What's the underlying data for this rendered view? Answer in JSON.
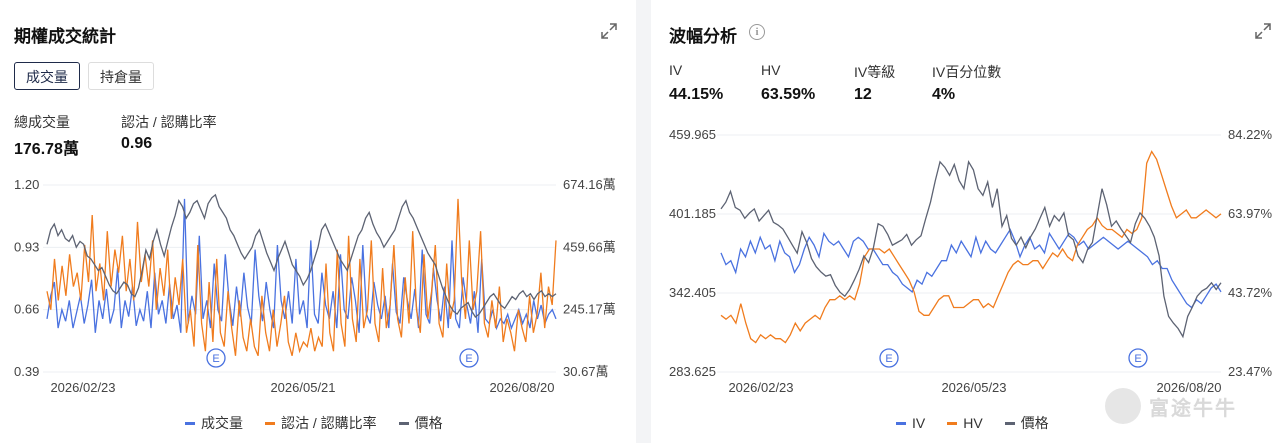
{
  "left_panel": {
    "title": "期權成交統計",
    "tabs": [
      {
        "label": "成交量"
      },
      {
        "label": "持倉量"
      }
    ],
    "stats": [
      {
        "label": "總成交量",
        "value": "176.78萬"
      },
      {
        "label": "認沽 / 認購比率",
        "value": "0.96"
      }
    ]
  },
  "right_panel": {
    "title": "波幅分析",
    "stats": [
      {
        "label": "IV",
        "value": "44.15%"
      },
      {
        "label": "HV",
        "value": "63.59%"
      },
      {
        "label": "IV等級",
        "value": "12"
      },
      {
        "label": "IV百分位數",
        "value": "4%"
      }
    ]
  },
  "icons": {
    "expand": "expand-icon",
    "info": "info-icon",
    "earnings": "earnings-marker-icon",
    "logo": "futu-logo-icon"
  },
  "colors": {
    "blue": "#4a72e0",
    "orange": "#f07c1e",
    "gray": "#5d6373"
  },
  "watermark": "富途牛牛",
  "chart_data": [
    {
      "type": "line",
      "x_ticks": [
        "2026/02/23",
        "2026/05/21",
        "2026/08/20"
      ],
      "y_left": {
        "ticks": [
          "1.20",
          "0.93",
          "0.66",
          "0.39"
        ],
        "range": [
          0.39,
          1.2
        ]
      },
      "y_right": {
        "ticks": [
          "674.16萬",
          "459.66萬",
          "245.17萬",
          "30.67萬"
        ],
        "range": [
          30.67,
          674.16
        ],
        "unit": "萬"
      },
      "markers": [
        "E",
        "E"
      ],
      "series": [
        {
          "name": "成交量",
          "axis": "left",
          "color": "#4a72e0",
          "values": [
            0.62,
            0.72,
            0.78,
            0.58,
            0.66,
            0.61,
            0.7,
            0.58,
            0.65,
            0.72,
            0.6,
            0.68,
            0.79,
            0.56,
            0.7,
            0.62,
            0.75,
            0.6,
            0.66,
            0.84,
            0.58,
            0.7,
            0.63,
            0.76,
            0.59,
            0.66,
            0.61,
            0.74,
            0.58,
            0.82,
            0.64,
            0.7,
            0.6,
            0.77,
            0.62,
            0.68,
            0.56,
            1.14,
            0.6,
            0.72,
            0.64,
            0.98,
            0.62,
            0.7,
            0.58,
            0.86,
            0.66,
            0.61,
            0.9,
            0.7,
            0.59,
            0.76,
            0.63,
            0.82,
            0.67,
            0.6,
            0.92,
            0.72,
            0.61,
            0.78,
            0.66,
            0.58,
            0.94,
            0.7,
            0.62,
            0.74,
            0.6,
            0.88,
            0.64,
            0.7,
            0.58,
            0.96,
            0.64,
            0.6,
            0.82,
            0.68,
            0.62,
            0.74,
            0.58,
            0.9,
            0.66,
            0.62,
            0.8,
            0.7,
            0.56,
            0.94,
            0.64,
            0.6,
            0.78,
            0.68,
            0.62,
            0.72,
            0.58,
            0.86,
            0.65,
            0.6,
            0.8,
            0.7,
            0.62,
            0.75,
            0.58,
            0.92,
            0.64,
            0.6,
            0.84,
            0.7,
            0.61,
            0.76,
            0.58,
            0.96,
            0.62,
            0.58,
            0.8,
            0.68,
            0.6,
            0.74,
            0.56,
            0.88,
            0.62,
            0.6,
            0.66,
            0.58,
            0.62,
            0.6,
            0.64,
            0.58,
            0.62,
            0.66,
            0.6,
            0.64,
            0.58,
            0.7,
            0.62,
            0.68,
            0.6,
            0.64,
            0.66,
            0.62
          ]
        },
        {
          "name": "認沽 / 認購比率",
          "axis": "left",
          "color": "#f07c1e",
          "values": [
            0.74,
            0.66,
            0.88,
            0.7,
            0.85,
            0.72,
            0.9,
            0.76,
            0.82,
            0.7,
            0.94,
            0.78,
            1.07,
            0.74,
            0.86,
            0.7,
            1.0,
            0.76,
            0.92,
            0.82,
            0.98,
            0.74,
            0.88,
            0.7,
            1.04,
            0.78,
            0.9,
            0.76,
            0.96,
            0.66,
            0.84,
            0.72,
            0.92,
            0.62,
            0.8,
            0.68,
            0.88,
            0.56,
            0.66,
            0.5,
            0.94,
            0.6,
            0.48,
            0.78,
            0.52,
            0.88,
            0.56,
            0.5,
            0.74,
            0.58,
            0.46,
            0.7,
            0.54,
            0.48,
            0.62,
            0.5,
            0.46,
            0.72,
            0.56,
            0.48,
            0.66,
            0.5,
            0.6,
            0.72,
            0.52,
            0.46,
            0.56,
            0.48,
            0.52,
            0.5,
            0.58,
            0.48,
            0.54,
            0.5,
            0.86,
            0.56,
            0.48,
            0.92,
            0.6,
            0.5,
            0.98,
            0.62,
            0.52,
            0.88,
            0.58,
            0.66,
            0.96,
            0.6,
            0.52,
            0.84,
            0.58,
            0.68,
            0.94,
            0.62,
            0.54,
            0.8,
            0.6,
            1.0,
            0.66,
            0.56,
            0.9,
            0.62,
            0.74,
            0.94,
            0.6,
            0.54,
            0.86,
            0.62,
            0.7,
            1.14,
            0.78,
            0.62,
            0.96,
            0.66,
            0.74,
            1.0,
            0.6,
            0.54,
            0.7,
            0.58,
            0.76,
            0.52,
            0.62,
            0.56,
            0.48,
            0.66,
            0.58,
            0.52,
            0.72,
            0.56,
            0.64,
            0.82,
            0.58,
            0.76,
            0.68,
            0.96
          ]
        },
        {
          "name": "價格",
          "axis": "right",
          "color": "#5d6373",
          "values": [
            470,
            520,
            540,
            500,
            520,
            490,
            480,
            500,
            460,
            480,
            470,
            430,
            420,
            400,
            380,
            390,
            360,
            330,
            310,
            300,
            320,
            340,
            330,
            300,
            290,
            320,
            380,
            450,
            420,
            480,
            520,
            470,
            430,
            480,
            530,
            570,
            620,
            600,
            560,
            580,
            610,
            620,
            590,
            560,
            610,
            630,
            640,
            600,
            580,
            560,
            520,
            500,
            470,
            440,
            420,
            440,
            460,
            500,
            520,
            480,
            440,
            410,
            380,
            420,
            450,
            480,
            440,
            400,
            380,
            360,
            330,
            350,
            380,
            420,
            460,
            520,
            540,
            510,
            480,
            450,
            420,
            400,
            380,
            420,
            460,
            500,
            520,
            560,
            580,
            540,
            510,
            490,
            460,
            480,
            500,
            520,
            560,
            600,
            620,
            580,
            560,
            530,
            500,
            470,
            440,
            420,
            400,
            360,
            320,
            290,
            260,
            240,
            230,
            250,
            260,
            270,
            240,
            220,
            230,
            250,
            270,
            290,
            300,
            280,
            260,
            250,
            270,
            290,
            280,
            300,
            310,
            290,
            300,
            280,
            300,
            310,
            290,
            300,
            290,
            300
          ]
        }
      ]
    },
    {
      "type": "line",
      "x_ticks": [
        "2026/02/23",
        "2026/05/23",
        "2026/08/20"
      ],
      "y_left": {
        "ticks": [
          "459.965",
          "401.185",
          "342.405",
          "283.625"
        ],
        "range": [
          283.625,
          459.965
        ]
      },
      "y_right": {
        "ticks": [
          "84.22%",
          "63.97%",
          "43.72%",
          "23.47%"
        ],
        "range": [
          23.47,
          84.22
        ]
      },
      "markers": [
        "E",
        "E"
      ],
      "series": [
        {
          "name": "IV",
          "axis": "right",
          "color": "#4a72e0",
          "values": [
            54,
            51,
            52,
            49,
            55,
            53,
            57,
            54,
            58,
            55,
            56,
            52,
            57,
            54,
            53,
            49,
            51,
            55,
            58,
            56,
            53,
            59,
            57,
            56,
            57,
            55,
            53,
            57,
            58,
            57,
            55,
            55,
            53,
            51,
            51,
            49,
            48,
            46,
            45,
            44,
            47,
            46,
            49,
            48,
            50,
            52,
            52,
            56,
            54,
            57,
            55,
            53,
            58,
            54,
            57,
            55,
            54,
            56,
            58,
            60,
            57,
            53,
            56,
            58,
            55,
            56,
            54,
            59,
            57,
            55,
            57,
            59,
            58,
            56,
            57,
            55,
            56,
            57,
            58,
            57,
            56,
            55,
            56,
            57,
            56,
            55,
            54,
            53,
            51,
            52,
            50,
            50,
            47,
            45,
            43,
            41,
            40,
            42,
            41,
            43,
            45,
            46,
            44
          ]
        },
        {
          "name": "HV",
          "axis": "right",
          "color": "#f07c1e",
          "values": [
            38,
            37,
            38,
            36,
            41,
            36,
            32,
            31,
            33,
            32,
            33,
            32,
            32,
            31,
            33,
            36,
            34,
            36,
            37,
            38,
            37,
            40,
            42,
            42,
            43,
            42,
            43,
            42,
            46,
            53,
            55,
            55,
            55,
            54,
            55,
            53,
            51,
            49,
            47,
            44,
            39,
            38,
            38,
            40,
            42,
            43,
            43,
            40,
            40,
            40,
            41,
            42,
            42,
            40,
            41,
            40,
            43,
            46,
            49,
            51,
            52,
            51,
            51,
            52,
            52,
            50,
            52,
            54,
            53,
            55,
            53,
            52,
            56,
            58,
            60,
            61,
            63,
            61,
            60,
            60,
            59,
            58,
            60,
            59,
            60,
            63,
            77,
            80,
            78,
            74,
            70,
            66,
            63,
            64,
            65,
            63,
            63,
            64,
            65,
            64,
            63,
            64
          ]
        },
        {
          "name": "價格",
          "axis": "left",
          "color": "#5d6373",
          "values": [
            405,
            410,
            418,
            406,
            404,
            398,
            402,
            405,
            396,
            400,
            404,
            395,
            393,
            390,
            384,
            378,
            372,
            388,
            380,
            368,
            362,
            358,
            355,
            356,
            348,
            343,
            340,
            345,
            352,
            360,
            370,
            365,
            376,
            394,
            392,
            386,
            378,
            380,
            382,
            386,
            378,
            382,
            385,
            398,
            410,
            426,
            440,
            436,
            430,
            438,
            426,
            420,
            440,
            434,
            420,
            415,
            425,
            406,
            420,
            392,
            400,
            383,
            378,
            384,
            376,
            384,
            390,
            398,
            406,
            392,
            400,
            396,
            402,
            385,
            382,
            370,
            365,
            375,
            380,
            400,
            420,
            408,
            392,
            396,
            390,
            385,
            380,
            394,
            402,
            398,
            392,
            384,
            370,
            340,
            325,
            320,
            316,
            310,
            325,
            332,
            340,
            344,
            346,
            350,
            345,
            350
          ]
        }
      ]
    }
  ],
  "legend_left": [
    "成交量",
    "認沽 / 認購比率",
    "價格"
  ],
  "legend_right": [
    "IV",
    "HV",
    "價格"
  ]
}
